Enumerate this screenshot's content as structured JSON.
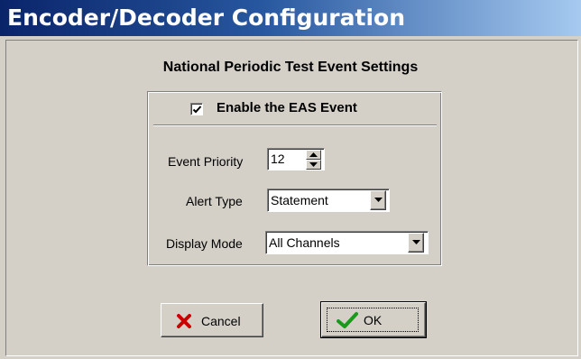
{
  "window": {
    "title": "Encoder/Decoder Configuration"
  },
  "dialog": {
    "heading": "National Periodic Test Event Settings",
    "enable_event": {
      "label": "Enable the EAS Event",
      "checked": true
    },
    "event_priority": {
      "label": "Event Priority",
      "value": "12"
    },
    "alert_type": {
      "label": "Alert Type",
      "value": "Statement"
    },
    "display_mode": {
      "label": "Display Mode",
      "value": "All Channels"
    }
  },
  "buttons": {
    "cancel": {
      "label": "Cancel",
      "icon": "red-x-icon"
    },
    "ok": {
      "label": "OK",
      "icon": "green-checkmark-icon"
    }
  },
  "colors": {
    "title_gradient_start": "#0a246a",
    "title_gradient_end": "#a6caf0",
    "dialog_face": "#d4d0c8",
    "cancel_icon": "#cc0000",
    "ok_icon": "#1a9a1a"
  }
}
